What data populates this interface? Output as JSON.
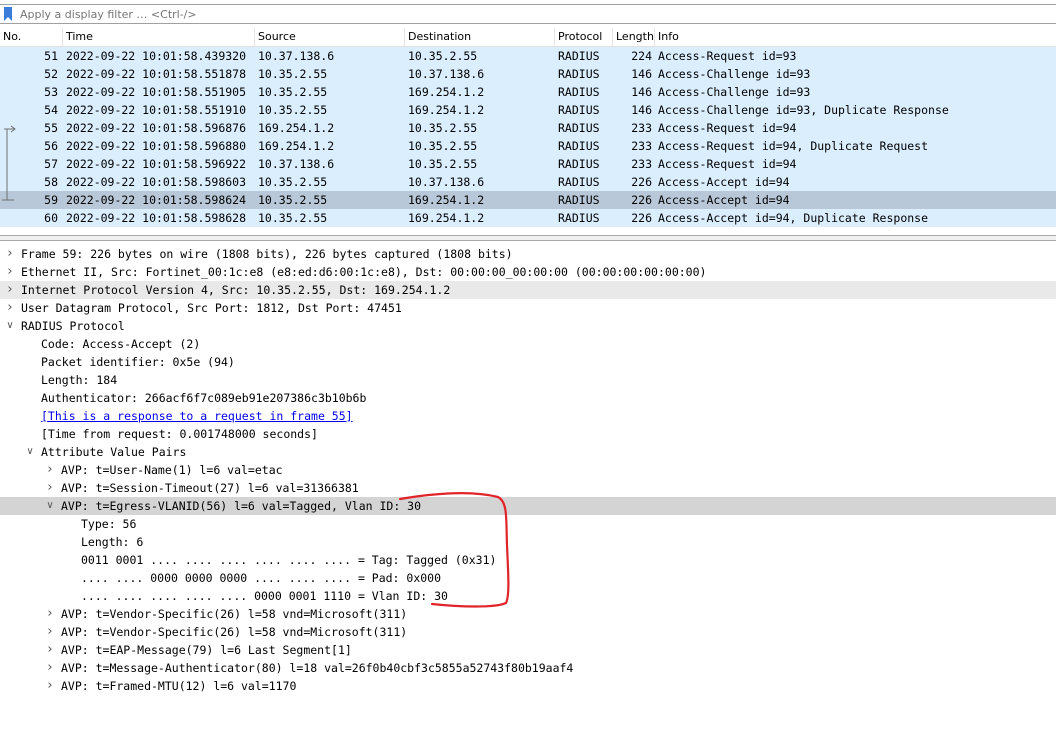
{
  "filter": {
    "placeholder": "Apply a display filter … <Ctrl-/>",
    "icon": "bookmark-icon"
  },
  "columns": [
    "No.",
    "Time",
    "Source",
    "Destination",
    "Protocol",
    "Length",
    "Info"
  ],
  "packets": [
    {
      "no": "51",
      "time": "2022-09-22 10:01:58.439320",
      "src": "10.37.138.6",
      "dst": "10.35.2.55",
      "proto": "RADIUS",
      "len": "224",
      "info": "Access-Request id=93"
    },
    {
      "no": "52",
      "time": "2022-09-22 10:01:58.551878",
      "src": "10.35.2.55",
      "dst": "10.37.138.6",
      "proto": "RADIUS",
      "len": "146",
      "info": "Access-Challenge id=93"
    },
    {
      "no": "53",
      "time": "2022-09-22 10:01:58.551905",
      "src": "10.35.2.55",
      "dst": "169.254.1.2",
      "proto": "RADIUS",
      "len": "146",
      "info": "Access-Challenge id=93"
    },
    {
      "no": "54",
      "time": "2022-09-22 10:01:58.551910",
      "src": "10.35.2.55",
      "dst": "169.254.1.2",
      "proto": "RADIUS",
      "len": "146",
      "info": "Access-Challenge id=93, Duplicate Response"
    },
    {
      "no": "55",
      "time": "2022-09-22 10:01:58.596876",
      "src": "169.254.1.2",
      "dst": "10.35.2.55",
      "proto": "RADIUS",
      "len": "233",
      "info": "Access-Request id=94"
    },
    {
      "no": "56",
      "time": "2022-09-22 10:01:58.596880",
      "src": "169.254.1.2",
      "dst": "10.35.2.55",
      "proto": "RADIUS",
      "len": "233",
      "info": "Access-Request id=94, Duplicate Request"
    },
    {
      "no": "57",
      "time": "2022-09-22 10:01:58.596922",
      "src": "10.37.138.6",
      "dst": "10.35.2.55",
      "proto": "RADIUS",
      "len": "233",
      "info": "Access-Request id=94"
    },
    {
      "no": "58",
      "time": "2022-09-22 10:01:58.598603",
      "src": "10.35.2.55",
      "dst": "10.37.138.6",
      "proto": "RADIUS",
      "len": "226",
      "info": "Access-Accept id=94"
    },
    {
      "no": "59",
      "time": "2022-09-22 10:01:58.598624",
      "src": "10.35.2.55",
      "dst": "169.254.1.2",
      "proto": "RADIUS",
      "len": "226",
      "info": "Access-Accept id=94"
    },
    {
      "no": "60",
      "time": "2022-09-22 10:01:58.598628",
      "src": "10.35.2.55",
      "dst": "169.254.1.2",
      "proto": "RADIUS",
      "len": "226",
      "info": "Access-Accept id=94, Duplicate Response"
    }
  ],
  "selected_packet": "59",
  "details": [
    {
      "text": "Frame 59: 226 bytes on wire (1808 bits), 226 bytes captured (1808 bits)",
      "level": 0,
      "arrow": "collapsed"
    },
    {
      "text": "Ethernet II, Src: Fortinet_00:1c:e8 (e8:ed:d6:00:1c:e8), Dst: 00:00:00_00:00:00 (00:00:00:00:00:00)",
      "level": 0,
      "arrow": "collapsed"
    },
    {
      "text": "Internet Protocol Version 4, Src: 10.35.2.55, Dst: 169.254.1.2",
      "level": 0,
      "arrow": "collapsed",
      "highlight": true
    },
    {
      "text": "User Datagram Protocol, Src Port: 1812, Dst Port: 47451",
      "level": 0,
      "arrow": "collapsed"
    },
    {
      "text": "RADIUS Protocol",
      "level": 0,
      "arrow": "expanded"
    },
    {
      "text": "Code: Access-Accept (2)",
      "level": 1
    },
    {
      "text": "Packet identifier: 0x5e (94)",
      "level": 1
    },
    {
      "text": "Length: 184",
      "level": 1
    },
    {
      "text": "Authenticator: 266acf6f7c089eb91e207386c3b10b6b",
      "level": 1
    },
    {
      "text": "[This is a response to a request in frame 55]",
      "level": 1,
      "link": true
    },
    {
      "text": "[Time from request: 0.001748000 seconds]",
      "level": 1
    },
    {
      "text": "Attribute Value Pairs",
      "level": 1,
      "arrow": "expanded"
    },
    {
      "text": "AVP: t=User-Name(1) l=6 val=etac",
      "level": 2,
      "arrow": "collapsed"
    },
    {
      "text": "AVP: t=Session-Timeout(27) l=6 val=31366381",
      "level": 2,
      "arrow": "collapsed"
    },
    {
      "text": "AVP: t=Egress-VLANID(56) l=6 val=Tagged, Vlan ID: 30",
      "level": 2,
      "arrow": "expanded",
      "selected": true
    },
    {
      "text": "Type: 56",
      "level": 3
    },
    {
      "text": "Length: 6",
      "level": 3
    },
    {
      "text": "0011 0001 .... .... .... .... .... .... = Tag: Tagged (0x31)",
      "level": 3
    },
    {
      "text": ".... .... 0000 0000 0000 .... .... .... = Pad: 0x000",
      "level": 3
    },
    {
      "text": ".... .... .... .... .... 0000 0001 1110 = Vlan ID: 30",
      "level": 3
    },
    {
      "text": "AVP: t=Vendor-Specific(26) l=58 vnd=Microsoft(311)",
      "level": 2,
      "arrow": "collapsed"
    },
    {
      "text": "AVP: t=Vendor-Specific(26) l=58 vnd=Microsoft(311)",
      "level": 2,
      "arrow": "collapsed"
    },
    {
      "text": "AVP: t=EAP-Message(79) l=6 Last Segment[1]",
      "level": 2,
      "arrow": "collapsed"
    },
    {
      "text": "AVP: t=Message-Authenticator(80) l=18 val=26f0b40cbf3c5855a52743f80b19aaf4",
      "level": 2,
      "arrow": "collapsed"
    },
    {
      "text": "AVP: t=Framed-MTU(12) l=6 val=1170",
      "level": 2,
      "arrow": "collapsed"
    }
  ],
  "colors": {
    "row_bg": "#daeefe",
    "row_selected": "#b8c8d8",
    "annotation": "#e0242a"
  }
}
